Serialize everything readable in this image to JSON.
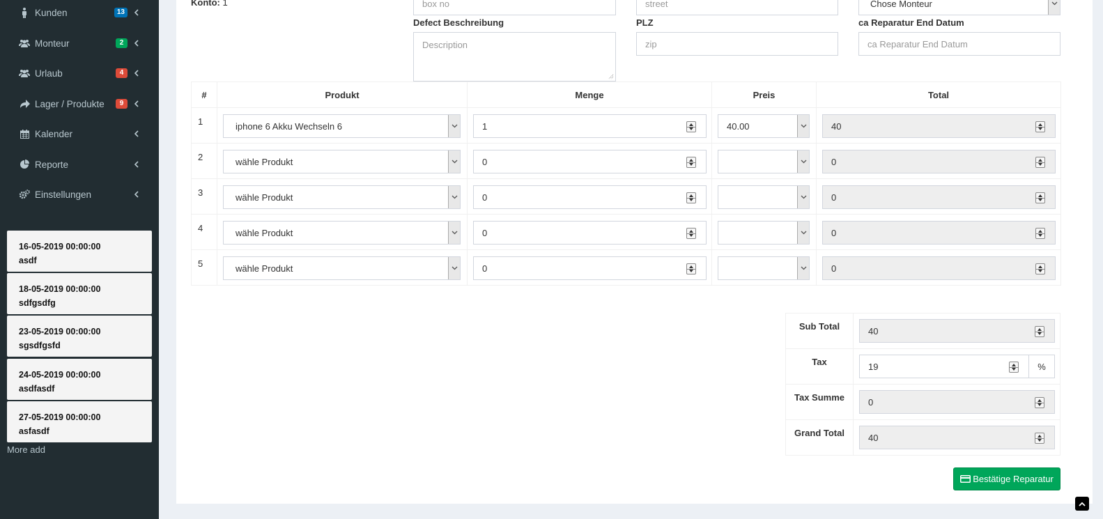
{
  "sidebar": {
    "items": [
      {
        "label": "Kunden",
        "icon": "male-icon",
        "badge": "13",
        "badge_color": "#0073b7"
      },
      {
        "label": "Monteur",
        "icon": "users-icon",
        "badge": "2",
        "badge_color": "#00a65a"
      },
      {
        "label": "Urlaub",
        "icon": "users-icon",
        "badge": "4",
        "badge_color": "#dd4b39"
      },
      {
        "label": "Lager / Produkte",
        "icon": "share-icon",
        "badge": "9",
        "badge_color": "#dd4b39"
      },
      {
        "label": "Kalender",
        "icon": "calendar-icon",
        "badge": null
      },
      {
        "label": "Reporte",
        "icon": "pie-chart-icon",
        "badge": null
      },
      {
        "label": "Einstellungen",
        "icon": "cogs-icon",
        "badge": null
      }
    ],
    "events": [
      {
        "date": "16-05-2019 00:00:00",
        "title": "asdf"
      },
      {
        "date": "18-05-2019 00:00:00",
        "title": "sdfgsdfg"
      },
      {
        "date": "23-05-2019 00:00:00",
        "title": "sgsdfgsfd"
      },
      {
        "date": "24-05-2019 00:00:00",
        "title": "asdfasdf"
      },
      {
        "date": "27-05-2019 00:00:00",
        "title": "asfasdf"
      }
    ],
    "more_label": "More add"
  },
  "form": {
    "konto_label": "Konto:",
    "konto_value": "1",
    "box_placeholder": "box no",
    "street_placeholder": "street",
    "monteur_select": "Chose Monteur",
    "defect_label": "Defect Beschreibung",
    "defect_placeholder": "Description",
    "plz_label": "PLZ",
    "plz_placeholder": "zip",
    "end_date_label": "ca Reparatur End Datum",
    "end_date_placeholder": "ca Reparatur End Datum"
  },
  "table": {
    "headers": [
      "#",
      "Produkt",
      "Menge",
      "Preis",
      "Total"
    ],
    "rows": [
      {
        "num": "1",
        "product": "iphone 6 Akku Wechseln 6",
        "qty": "1",
        "price": "40.00",
        "total": "40"
      },
      {
        "num": "2",
        "product": "wähle Produkt",
        "qty": "0",
        "price": "",
        "total": "0"
      },
      {
        "num": "3",
        "product": "wähle Produkt",
        "qty": "0",
        "price": "",
        "total": "0"
      },
      {
        "num": "4",
        "product": "wähle Produkt",
        "qty": "0",
        "price": "",
        "total": "0"
      },
      {
        "num": "5",
        "product": "wähle Produkt",
        "qty": "0",
        "price": "",
        "total": "0"
      }
    ]
  },
  "totals": {
    "subtotal_label": "Sub Total",
    "subtotal": "40",
    "tax_label": "Tax",
    "tax": "19",
    "tax_unit": "%",
    "tax_sum_label": "Tax Summe",
    "tax_sum": "0",
    "grand_total_label": "Grand Total",
    "grand_total": "40"
  },
  "confirm_label": "Bestätige Reparatur",
  "colors": {
    "sidebar_bg": "#222d32",
    "primary_green": "#00a65a"
  }
}
